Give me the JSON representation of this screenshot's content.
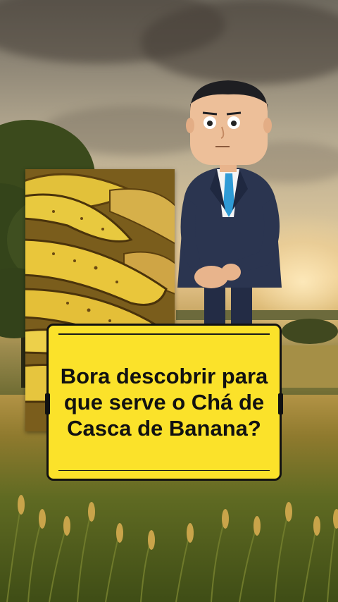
{
  "caption": {
    "text": "Bora descobrir para que serve o Chá de Casca de Banana?"
  },
  "scene": {
    "background": "sunset-wheat-field",
    "foreground_image": "banana-peels",
    "character": "cartoon-businessman"
  },
  "colors": {
    "caption_background": "#fbe22a",
    "caption_text": "#111111",
    "suit": "#2b3550",
    "tie": "#2f9bd6"
  }
}
